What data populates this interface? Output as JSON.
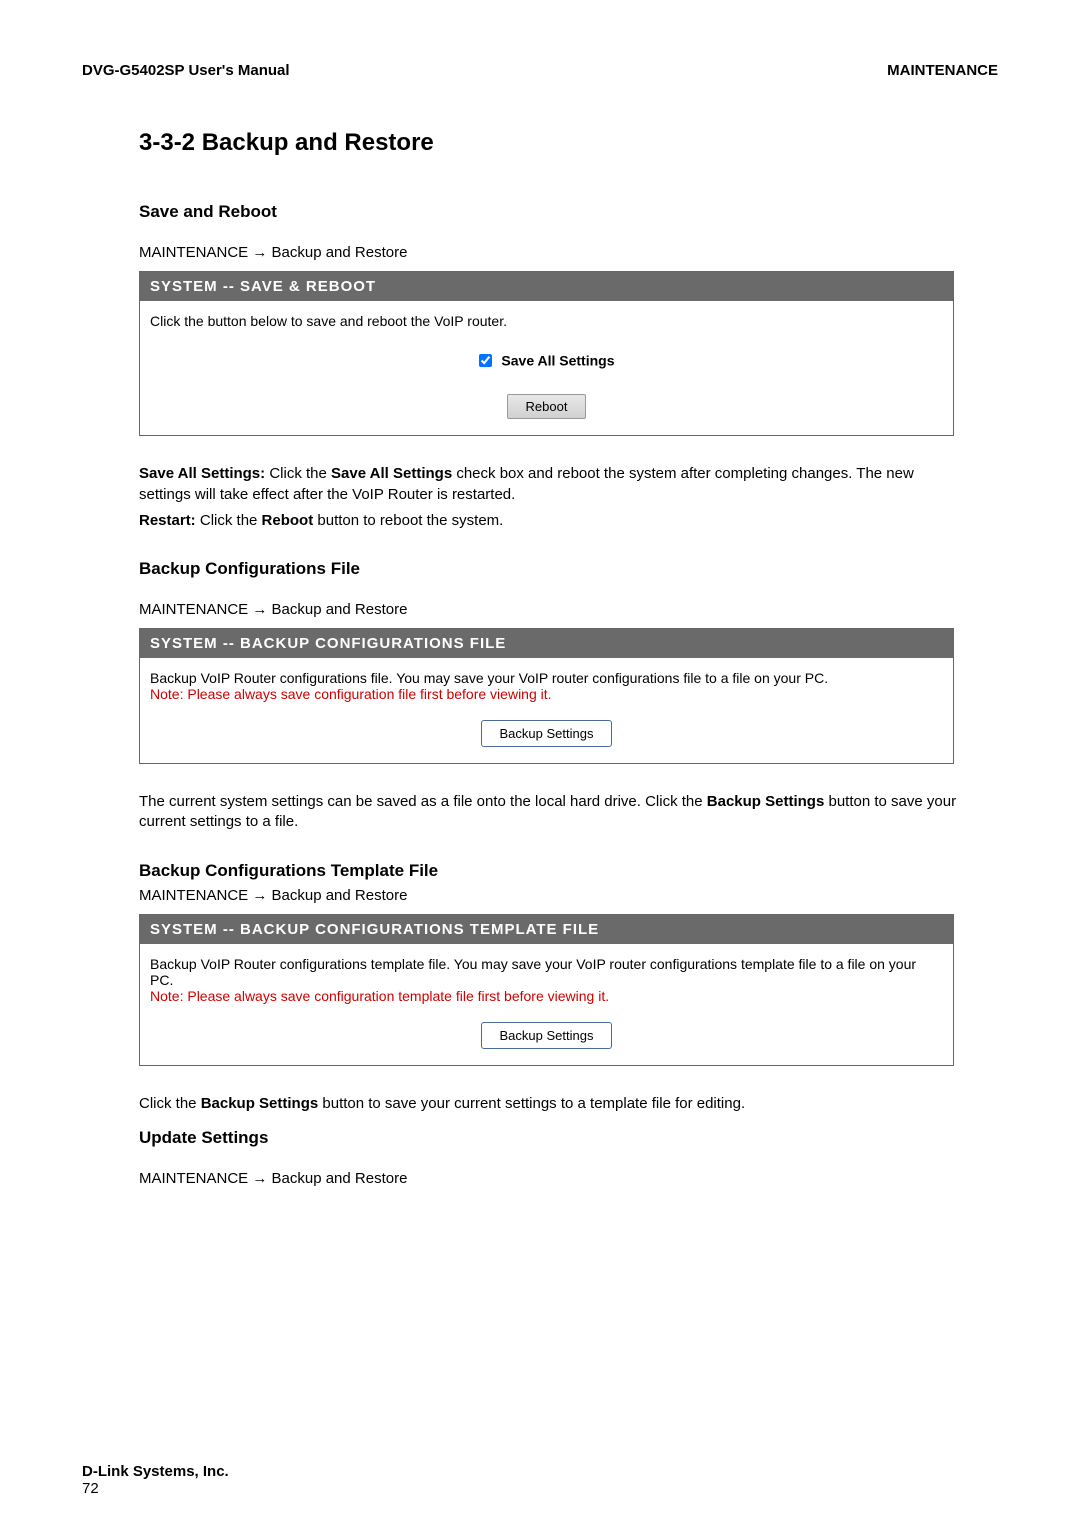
{
  "header": {
    "left": "DVG-G5402SP User's Manual",
    "right": "MAINTENANCE"
  },
  "section_title": "3-3-2 Backup and Restore",
  "save_reboot": {
    "heading": "Save and Reboot",
    "breadcrumb": "MAINTENANCE  →  Backup and Restore",
    "panel_title": "SYSTEM -- SAVE & REBOOT",
    "intro": "Click the button below to save and reboot the VoIP router.",
    "checkbox_label": "Save All Settings",
    "button_label": "Reboot",
    "explain_label_1a": "Save All Settings:",
    "explain_text_1a": " Click the ",
    "explain_bold_1b": "Save All Settings",
    "explain_text_1b": " check box and reboot the system after completing changes. The new settings will take effect after the VoIP Router is restarted.",
    "explain_label_2a": "Restart:",
    "explain_text_2a": " Click the ",
    "explain_bold_2b": "Reboot",
    "explain_text_2b": " button to reboot the system."
  },
  "backup_file": {
    "heading": "Backup Configurations File",
    "breadcrumb": "MAINTENANCE  →  Backup and Restore",
    "panel_title": "SYSTEM -- BACKUP CONFIGURATIONS FILE",
    "intro": "Backup VoIP Router configurations file. You may save your VoIP router configurations file to a file on your PC.",
    "note": "Note: Please always save configuration file first before viewing it.",
    "button_label": "Backup Settings",
    "explain_pre": "The current system settings can be saved as a file onto the local hard drive. Click the ",
    "explain_bold": "Backup Settings",
    "explain_post": " button to save your current settings to a file."
  },
  "backup_template": {
    "heading": "Backup Configurations Template File",
    "breadcrumb": "MAINTENANCE  →  Backup and Restore",
    "panel_title": "SYSTEM -- BACKUP CONFIGURATIONS TEMPLATE FILE",
    "intro": "Backup VoIP Router configurations template file. You may save your VoIP router configurations template file to a file on your PC.",
    "note": "Note: Please always save configuration template file first before viewing it.",
    "button_label": "Backup Settings",
    "explain_pre": "Click the ",
    "explain_bold": "Backup Settings",
    "explain_post": " button to save your current settings to a template file for editing."
  },
  "update_settings": {
    "heading": "Update Settings",
    "breadcrumb": "MAINTENANCE  →  Backup and Restore"
  },
  "footer": {
    "company": "D-Link Systems, Inc.",
    "page": "72"
  }
}
